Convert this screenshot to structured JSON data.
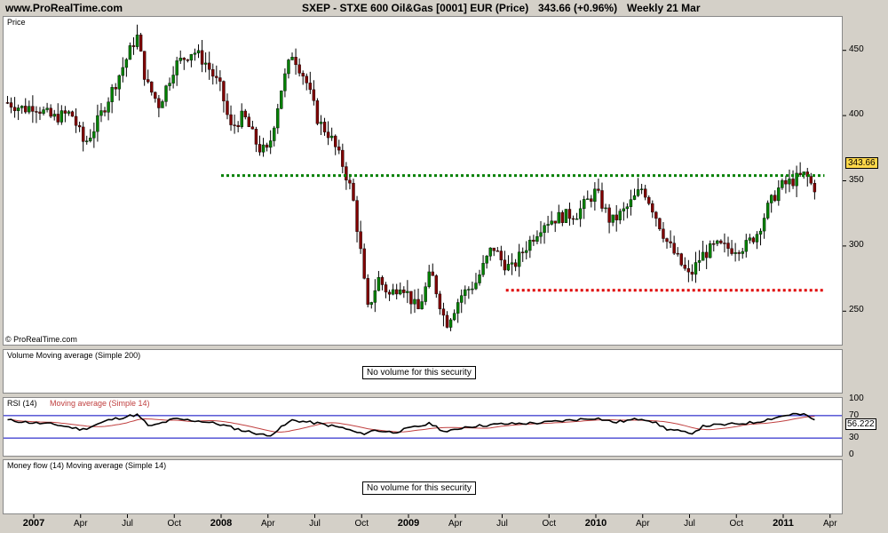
{
  "header": {
    "site": "www.ProRealTime.com",
    "title": "SXEP - STXE 600 Oil&Gas [0001] EUR (Price)",
    "price_change": "343.66 (+0.96%)",
    "period": "Weekly  21 Mar"
  },
  "panels": {
    "price_label": "Price",
    "copyright": "© ProRealTime.com",
    "volume_label": "Volume Moving average (Simple 200)",
    "volume_msg": "No volume for this security",
    "rsi_label": "RSI (14)",
    "rsi_ma_label": "Moving average (Simple 14)",
    "rsi_value": "56.222",
    "moneyflow_label": "Money flow (14)   Moving average (Simple 14)",
    "moneyflow_msg": "No volume for this security"
  },
  "colors": {
    "up_candle": "#008000",
    "down_candle": "#800000",
    "support_line": "#008000",
    "low_line": "#e00000",
    "rsi_line": "#000000",
    "rsi_ma": "#c04040",
    "rsi_bands": "#0000c0",
    "price_box": "#ffd84a"
  },
  "chart_data": {
    "type": "candlestick",
    "frequency": "weekly",
    "last_price": "343.66",
    "price_axis": {
      "ticks": [
        250,
        300,
        350,
        400,
        450
      ],
      "range": [
        225,
        475
      ]
    },
    "rsi_axis": {
      "ticks": [
        0,
        30,
        70,
        100
      ],
      "range": [
        0,
        100
      ],
      "bands": [
        30,
        70
      ]
    },
    "x_labels": [
      {
        "t": 0,
        "label": "2007",
        "year": true
      },
      {
        "t": 0.25,
        "label": "Apr"
      },
      {
        "t": 0.5,
        "label": "Jul"
      },
      {
        "t": 0.75,
        "label": "Oct"
      },
      {
        "t": 1,
        "label": "2008",
        "year": true
      },
      {
        "t": 1.25,
        "label": "Apr"
      },
      {
        "t": 1.5,
        "label": "Jul"
      },
      {
        "t": 1.75,
        "label": "Oct"
      },
      {
        "t": 2,
        "label": "2009",
        "year": true
      },
      {
        "t": 2.25,
        "label": "Apr"
      },
      {
        "t": 2.5,
        "label": "Jul"
      },
      {
        "t": 2.75,
        "label": "Oct"
      },
      {
        "t": 3,
        "label": "2010",
        "year": true
      },
      {
        "t": 3.25,
        "label": "Apr"
      },
      {
        "t": 3.5,
        "label": "Jul"
      },
      {
        "t": 3.75,
        "label": "Oct"
      },
      {
        "t": 4,
        "label": "2011",
        "year": true
      },
      {
        "t": 4.25,
        "label": "Apr"
      }
    ],
    "price_anchors": [
      [
        -0.14,
        410
      ],
      [
        -0.05,
        405
      ],
      [
        0.0,
        408
      ],
      [
        0.1,
        398
      ],
      [
        0.2,
        402
      ],
      [
        0.27,
        378
      ],
      [
        0.33,
        392
      ],
      [
        0.42,
        420
      ],
      [
        0.5,
        445
      ],
      [
        0.55,
        462
      ],
      [
        0.6,
        425
      ],
      [
        0.67,
        408
      ],
      [
        0.75,
        438
      ],
      [
        0.85,
        450
      ],
      [
        0.92,
        440
      ],
      [
        1.0,
        420
      ],
      [
        1.05,
        390
      ],
      [
        1.12,
        400
      ],
      [
        1.2,
        375
      ],
      [
        1.25,
        372
      ],
      [
        1.32,
        420
      ],
      [
        1.38,
        448
      ],
      [
        1.45,
        428
      ],
      [
        1.52,
        395
      ],
      [
        1.58,
        385
      ],
      [
        1.65,
        362
      ],
      [
        1.7,
        340
      ],
      [
        1.75,
        290
      ],
      [
        1.78,
        250
      ],
      [
        1.84,
        275
      ],
      [
        1.9,
        262
      ],
      [
        1.96,
        272
      ],
      [
        2.05,
        250
      ],
      [
        2.12,
        280
      ],
      [
        2.2,
        240
      ],
      [
        2.28,
        262
      ],
      [
        2.36,
        272
      ],
      [
        2.45,
        300
      ],
      [
        2.5,
        288
      ],
      [
        2.55,
        282
      ],
      [
        2.62,
        298
      ],
      [
        2.72,
        318
      ],
      [
        2.8,
        322
      ],
      [
        2.9,
        325
      ],
      [
        3.0,
        342
      ],
      [
        3.08,
        318
      ],
      [
        3.16,
        328
      ],
      [
        3.25,
        345
      ],
      [
        3.3,
        330
      ],
      [
        3.38,
        303
      ],
      [
        3.45,
        287
      ],
      [
        3.5,
        276
      ],
      [
        3.56,
        292
      ],
      [
        3.64,
        300
      ],
      [
        3.72,
        298
      ],
      [
        3.8,
        300
      ],
      [
        3.86,
        310
      ],
      [
        3.92,
        330
      ],
      [
        3.98,
        345
      ],
      [
        4.05,
        350
      ],
      [
        4.12,
        355
      ],
      [
        4.15,
        347
      ],
      [
        4.18,
        343.66
      ]
    ],
    "rsi_anchors": [
      [
        -0.14,
        62
      ],
      [
        0.0,
        57
      ],
      [
        0.12,
        54
      ],
      [
        0.26,
        45
      ],
      [
        0.4,
        62
      ],
      [
        0.55,
        72
      ],
      [
        0.62,
        50
      ],
      [
        0.75,
        64
      ],
      [
        0.9,
        60
      ],
      [
        1.0,
        54
      ],
      [
        1.12,
        43
      ],
      [
        1.2,
        38
      ],
      [
        1.25,
        33
      ],
      [
        1.38,
        62
      ],
      [
        1.52,
        56
      ],
      [
        1.65,
        48
      ],
      [
        1.75,
        37
      ],
      [
        1.82,
        44
      ],
      [
        1.92,
        40
      ],
      [
        2.0,
        47
      ],
      [
        2.12,
        56
      ],
      [
        2.2,
        40
      ],
      [
        2.3,
        50
      ],
      [
        2.5,
        55
      ],
      [
        2.7,
        57
      ],
      [
        2.9,
        63
      ],
      [
        3.0,
        66
      ],
      [
        3.1,
        58
      ],
      [
        3.25,
        65
      ],
      [
        3.3,
        60
      ],
      [
        3.38,
        46
      ],
      [
        3.45,
        42
      ],
      [
        3.5,
        37
      ],
      [
        3.58,
        52
      ],
      [
        3.7,
        54
      ],
      [
        3.85,
        58
      ],
      [
        3.95,
        66
      ],
      [
        4.05,
        73
      ],
      [
        4.12,
        71
      ],
      [
        4.16,
        64
      ],
      [
        4.18,
        56
      ]
    ],
    "support_level": 354,
    "support_span": [
      1.0,
      4.22
    ],
    "low_level": 266,
    "low_span": [
      2.52,
      4.22
    ]
  }
}
